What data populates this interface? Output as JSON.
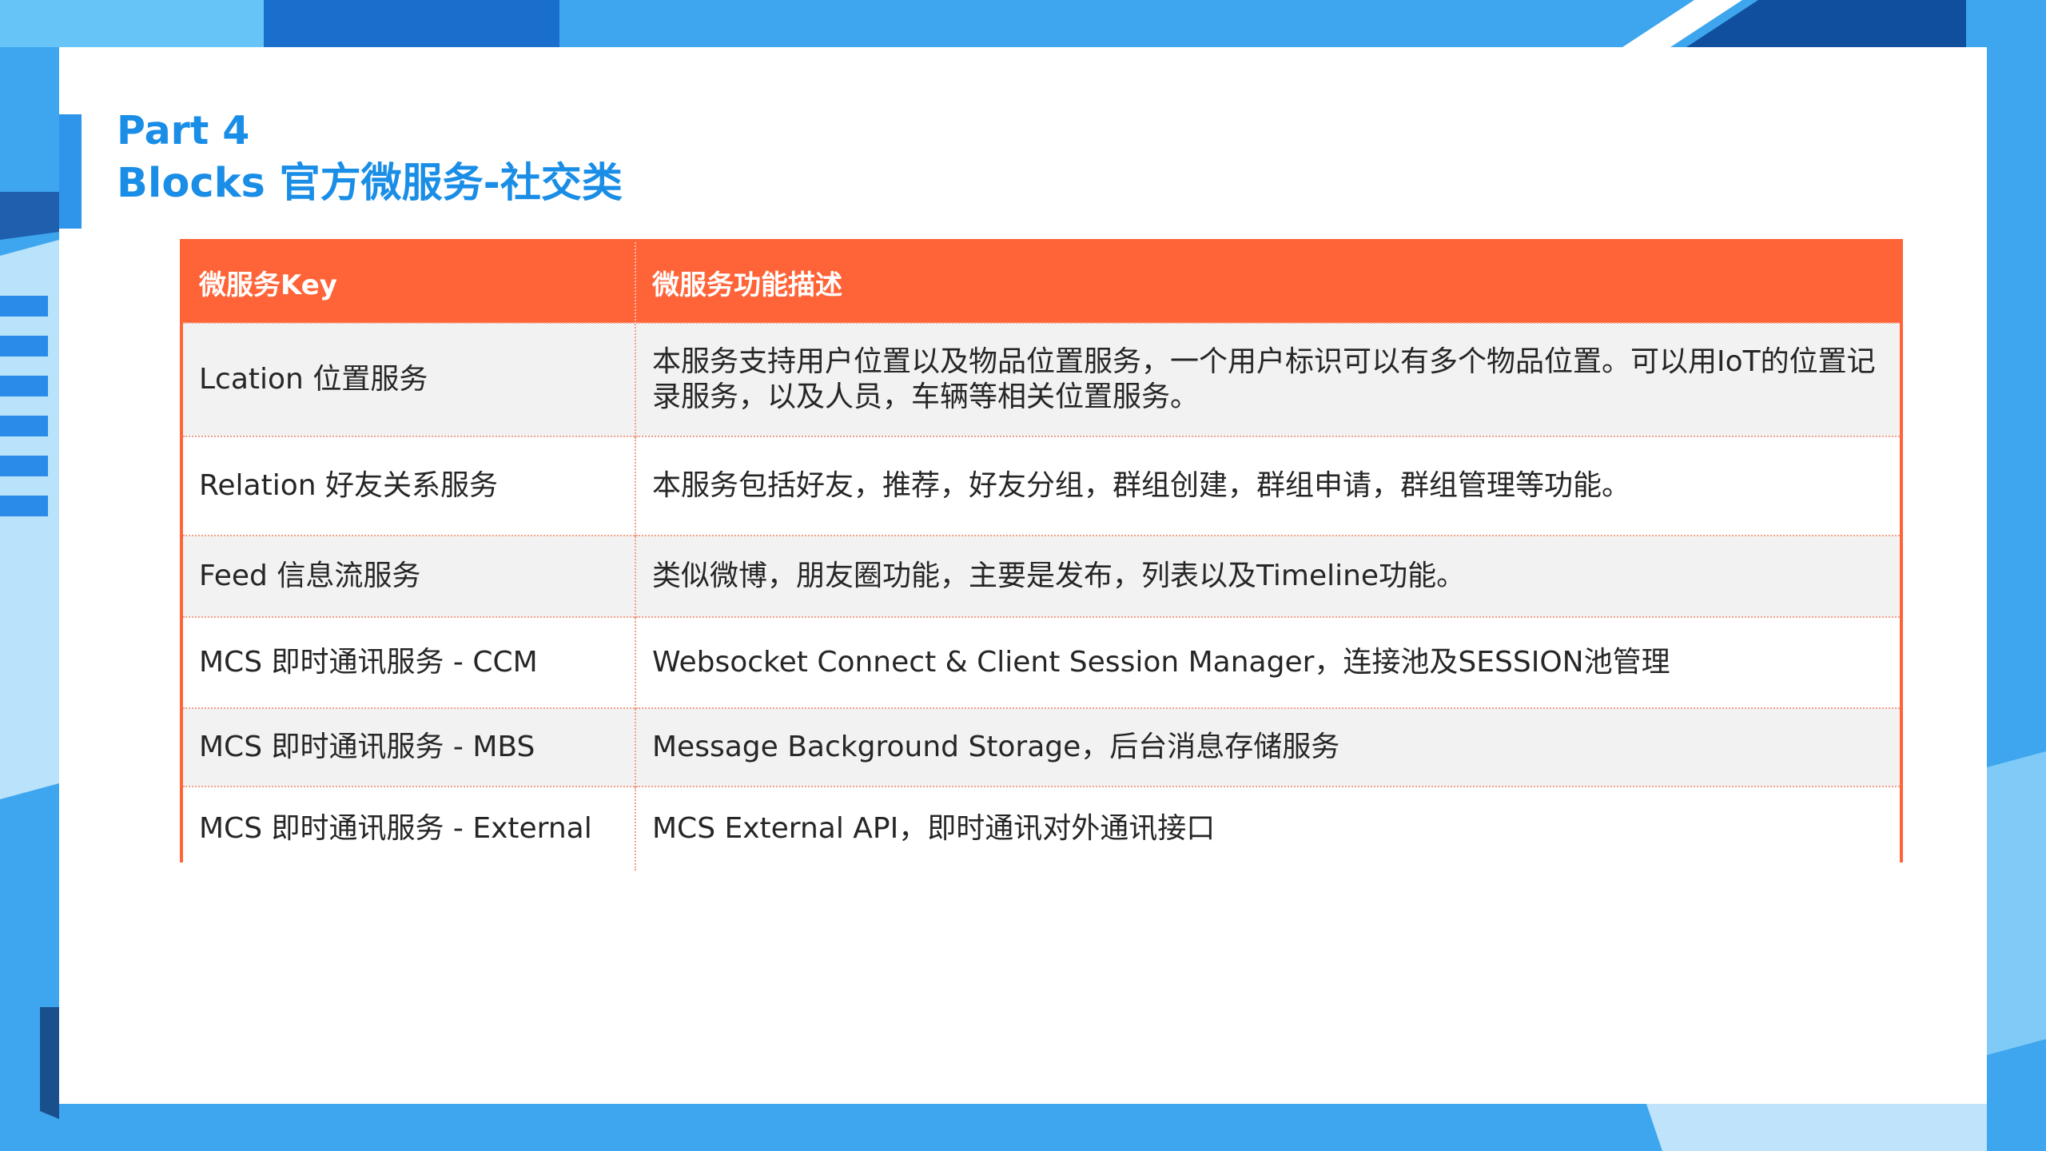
{
  "title": {
    "line1": "Part 4",
    "line2": "Blocks 官方微服务-社交类"
  },
  "colors": {
    "accent": "#1a8ee6",
    "header": "#ff6438",
    "background": "#4aaaf0"
  },
  "table": {
    "headers": [
      "微服务Key",
      "微服务功能描述"
    ],
    "rows": [
      {
        "key": "Lcation 位置服务",
        "desc": "本服务支持用户位置以及物品位置服务，一个用户标识可以有多个物品位置。可以用IoT的位置记录服务，以及人员，车辆等相关位置服务。"
      },
      {
        "key": "Relation 好友关系服务",
        "desc": "本服务包括好友，推荐，好友分组，群组创建，群组申请，群组管理等功能。"
      },
      {
        "key": "Feed 信息流服务",
        "desc": "类似微博，朋友圈功能，主要是发布，列表以及Timeline功能。"
      },
      {
        "key": "MCS 即时通讯服务 - CCM",
        "desc": "Websocket Connect & Client Session Manager，连接池及SESSION池管理"
      },
      {
        "key": "MCS 即时通讯服务 - MBS",
        "desc": "Message Background Storage，后台消息存储服务"
      },
      {
        "key": "MCS 即时通讯服务 - External",
        "desc": "MCS External API，即时通讯对外通讯接口"
      }
    ]
  }
}
